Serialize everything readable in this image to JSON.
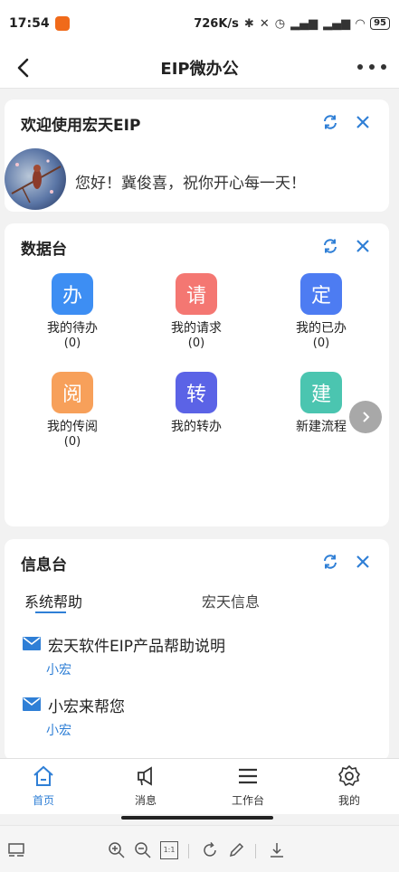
{
  "status_bar": {
    "time": "17:54",
    "network_speed": "726K/s",
    "battery": "95"
  },
  "header": {
    "title": "EIP微办公"
  },
  "welcome_card": {
    "title": "欢迎使用宏天EIP",
    "greeting": "您好！冀俊喜，祝你开心每一天！"
  },
  "data_card": {
    "title": "数据台",
    "tiles": [
      {
        "char": "办",
        "label": "我的待办",
        "count": "(0)",
        "color": "#3d8ef3"
      },
      {
        "char": "请",
        "label": "我的请求",
        "count": "(0)",
        "color": "#f47772"
      },
      {
        "char": "定",
        "label": "我的已办",
        "count": "(0)",
        "color": "#4d7cf2"
      },
      {
        "char": "阅",
        "label": "我的传阅",
        "count": "(0)",
        "color": "#f7a05a"
      },
      {
        "char": "转",
        "label": "我的转办",
        "count": "",
        "color": "#5b63e6"
      },
      {
        "char": "建",
        "label": "新建流程",
        "count": "",
        "color": "#4bc5b0"
      }
    ]
  },
  "info_card": {
    "title": "信息台",
    "tabs": [
      "系统帮助",
      "宏天信息"
    ],
    "messages": [
      {
        "title": "宏天软件EIP产品帮助说明",
        "author": "小宏"
      },
      {
        "title": "小宏来帮您",
        "author": "小宏"
      }
    ]
  },
  "bottom_nav": {
    "items": [
      {
        "label": "首页",
        "icon": "home-icon"
      },
      {
        "label": "消息",
        "icon": "megaphone-icon"
      },
      {
        "label": "工作台",
        "icon": "menu-icon"
      },
      {
        "label": "我的",
        "icon": "gear-icon"
      }
    ]
  },
  "viewer_toolbar": {
    "zoom_reset_label": "1:1"
  },
  "colors": {
    "accent": "#2f7fd6"
  }
}
